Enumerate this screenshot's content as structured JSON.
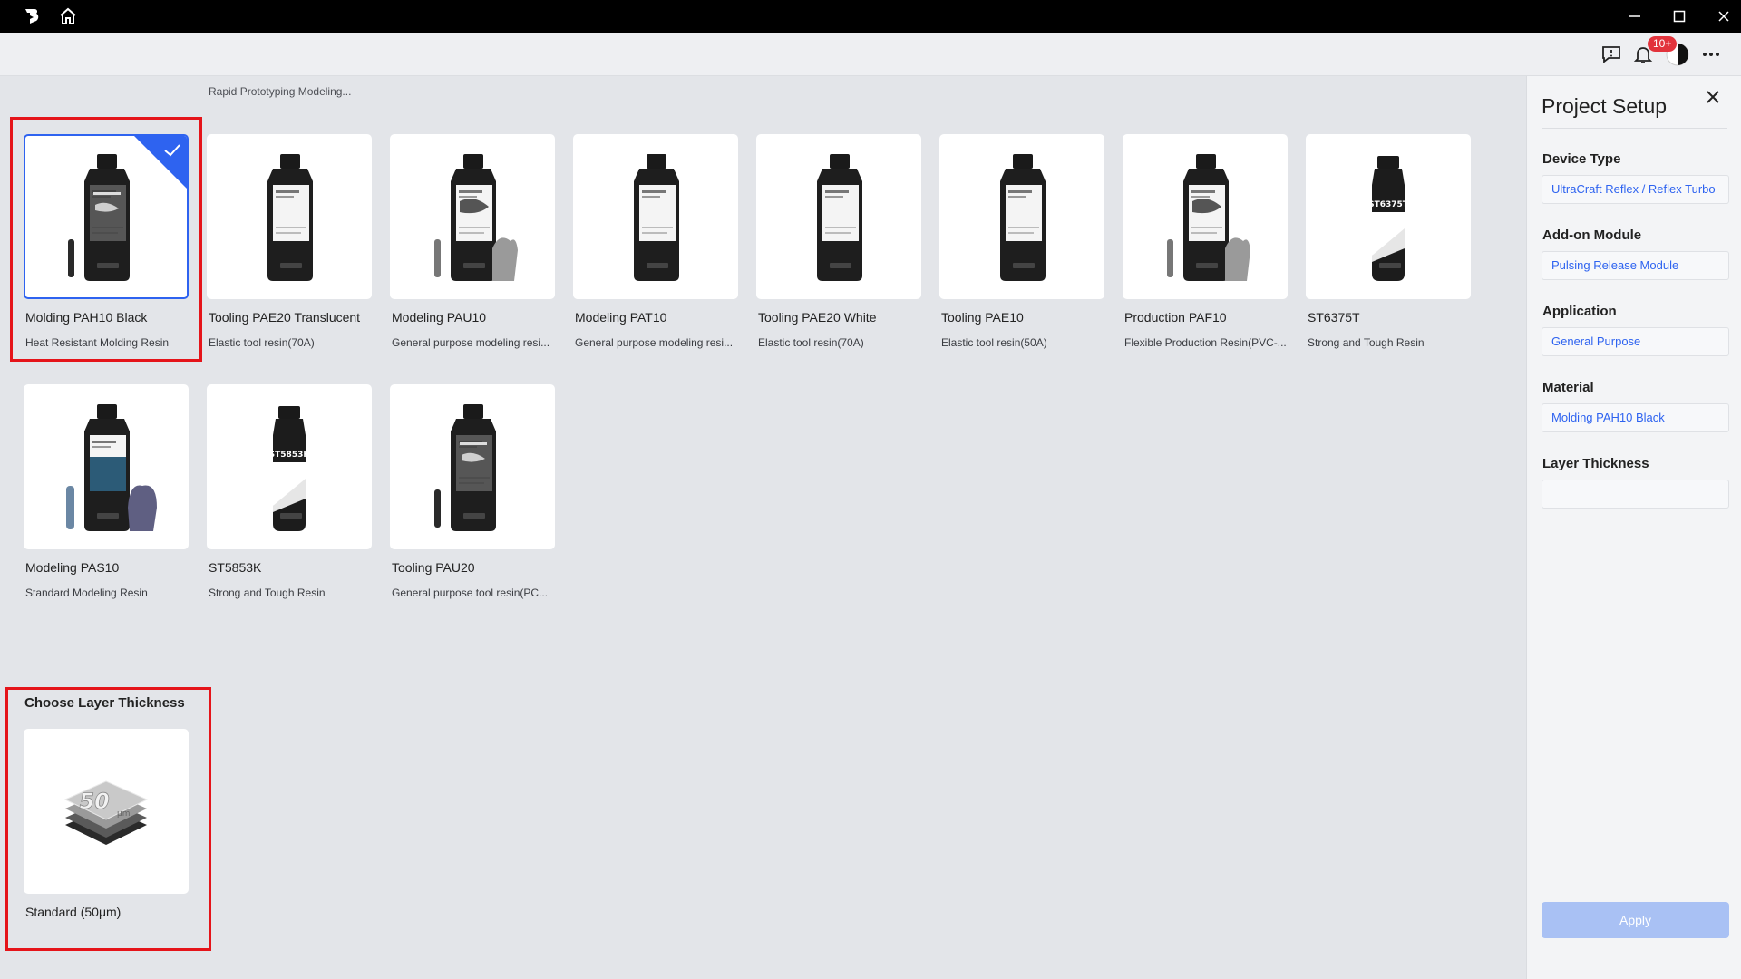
{
  "toolbar": {
    "notification_count": "10+"
  },
  "top_row_peek": [
    "Rapid Prototyping Modeling..."
  ],
  "materials": [
    {
      "name": "Molding PAH10 Black",
      "desc": "Heat Resistant Molding Resin",
      "label": "",
      "selected": true
    },
    {
      "name": "Tooling PAE20 Translucent",
      "desc": "Elastic tool resin(70A)",
      "label": ""
    },
    {
      "name": "Modeling PAU10",
      "desc": "General purpose modeling resi...",
      "label": ""
    },
    {
      "name": "Modeling PAT10",
      "desc": "General purpose modeling resi...",
      "label": ""
    },
    {
      "name": "Tooling PAE20 White",
      "desc": "Elastic tool resin(70A)",
      "label": ""
    },
    {
      "name": "Tooling PAE10",
      "desc": "Elastic tool resin(50A)",
      "label": ""
    },
    {
      "name": "Production PAF10",
      "desc": "Flexible Production Resin(PVC-...",
      "label": ""
    },
    {
      "name": "ST6375T",
      "desc": "Strong and Tough Resin",
      "label": "ST6375T"
    },
    {
      "name": "Modeling PAS10",
      "desc": "Standard Modeling Resin",
      "label": ""
    },
    {
      "name": "ST5853K",
      "desc": "Strong and Tough Resin",
      "label": "ST5853K"
    },
    {
      "name": "Tooling PAU20",
      "desc": "General purpose tool resin(PC...",
      "label": ""
    }
  ],
  "layer_section": {
    "title": "Choose Layer Thickness",
    "option_label": "Standard (50μm)",
    "thumb_text": "50",
    "thumb_unit": "μm"
  },
  "panel": {
    "title": "Project Setup",
    "device_type_label": "Device Type",
    "device_type_value": "UltraCraft Reflex / Reflex Turbo",
    "addon_label": "Add-on Module",
    "addon_value": "Pulsing Release Module",
    "application_label": "Application",
    "application_value": "General Purpose",
    "material_label": "Material",
    "material_value": "Molding PAH10 Black",
    "layer_label": "Layer Thickness",
    "layer_value": "",
    "apply_label": "Apply"
  },
  "colors": {
    "accent": "#2e63f0",
    "highlight": "#e5141a",
    "apply_disabled": "#a9c1f4"
  }
}
